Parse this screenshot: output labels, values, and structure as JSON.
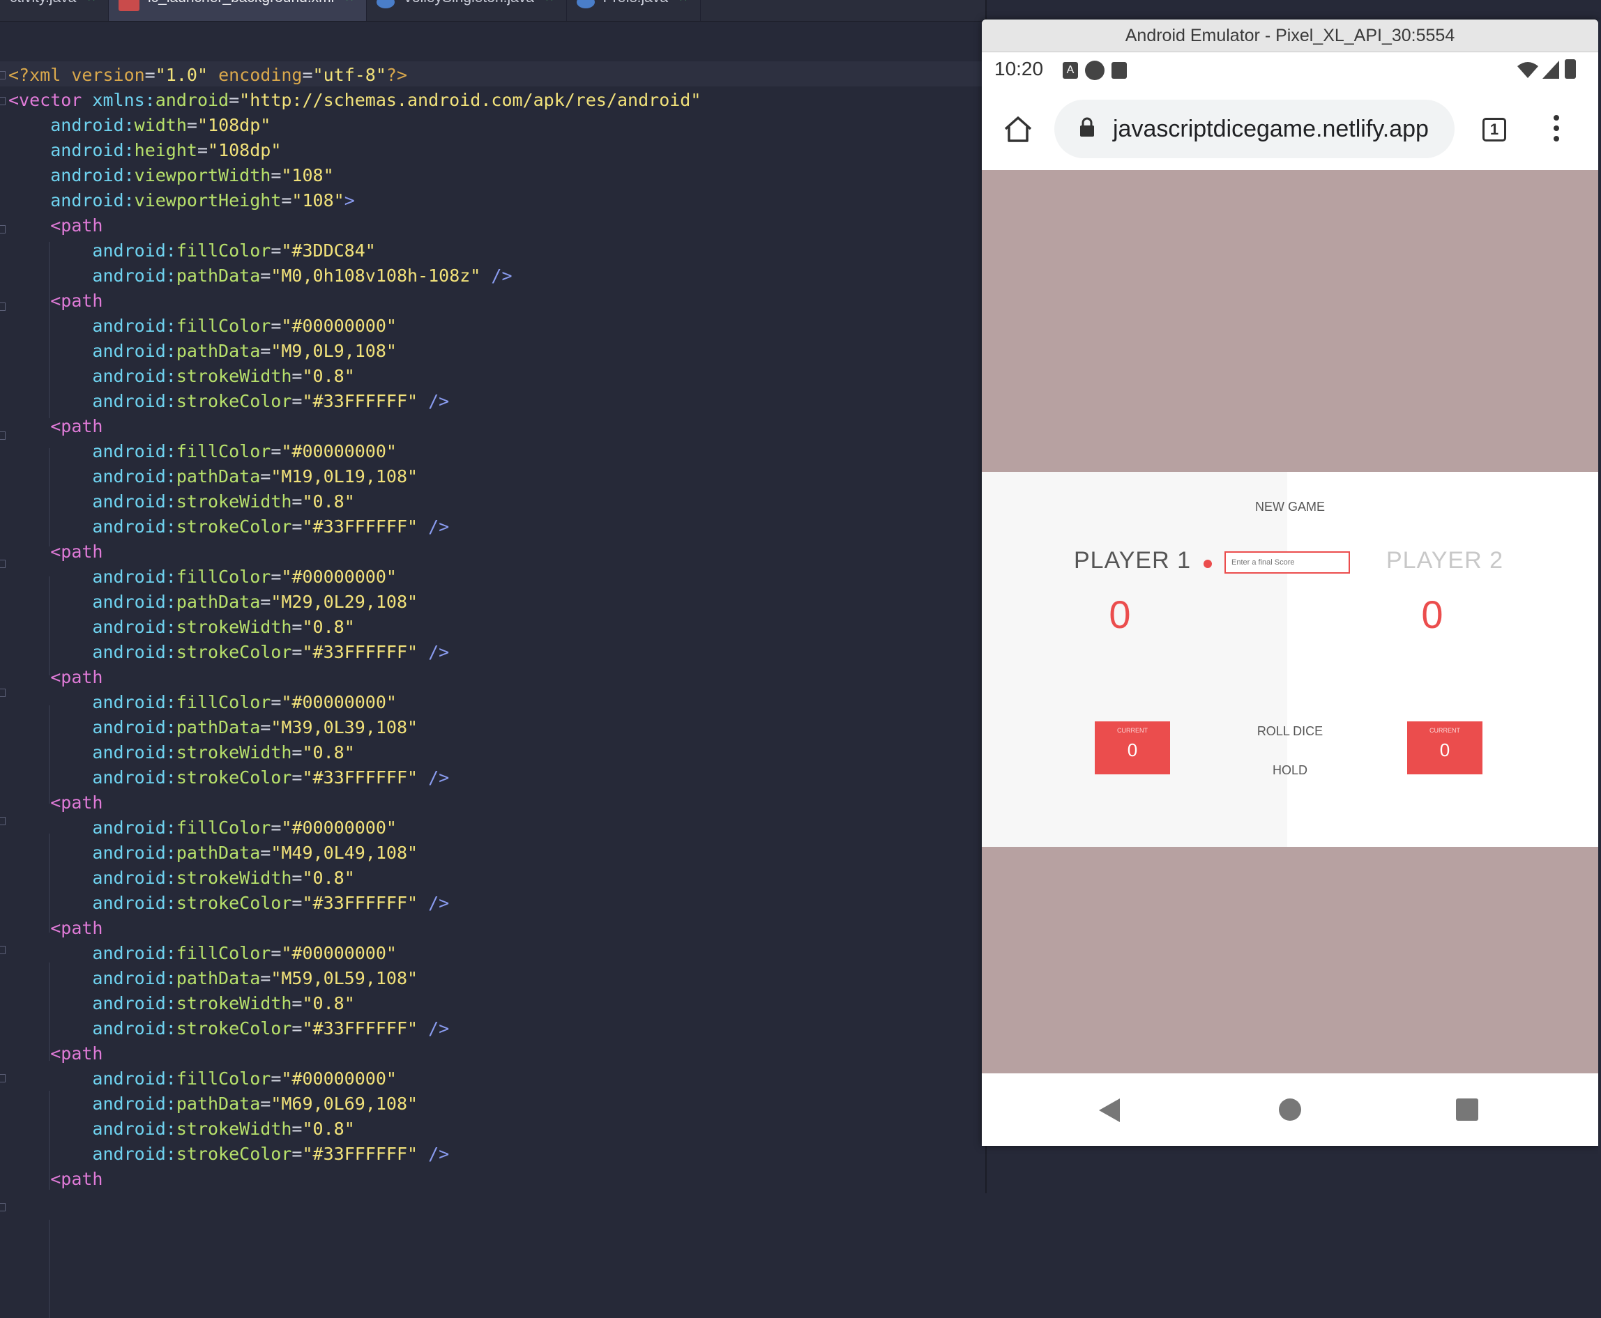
{
  "tabs": [
    {
      "label": "ctivity.java",
      "icon": "java-class-icon",
      "active": false
    },
    {
      "label": "ic_launcher_background.xml",
      "icon": "xml-file-icon",
      "active": true
    },
    {
      "label": "VolleySingleton.java",
      "icon": "java-class-icon",
      "active": false
    },
    {
      "label": "Prefs.java",
      "icon": "java-class-icon",
      "active": false
    }
  ],
  "emulator": {
    "title": "Android Emulator - Pixel_XL_API_30:5554",
    "status_time": "10:20",
    "url": "javascriptdicegame.netlify.app",
    "tab_count": "1"
  },
  "game": {
    "new_game": "NEW GAME",
    "player1": "PLAYER 1",
    "player2": "PLAYER 2",
    "final_score_placeholder": "Enter a final Score",
    "score1": "0",
    "score2": "0",
    "current_label": "CURRENT",
    "current1": "0",
    "current2": "0",
    "roll_dice": "ROLL DICE",
    "hold": "HOLD"
  },
  "code_lines": [
    [
      [
        "decl",
        "<?xml "
      ],
      [
        "decl",
        "version"
      ],
      [
        "plain",
        "="
      ],
      [
        "str",
        "\"1.0\""
      ],
      [
        "plain",
        " "
      ],
      [
        "decl",
        "encoding"
      ],
      [
        "plain",
        "="
      ],
      [
        "str",
        "\"utf-8\""
      ],
      [
        "decl",
        "?>"
      ]
    ],
    [
      [
        "tag",
        "<vector "
      ],
      [
        "ns",
        "xmlns:"
      ],
      [
        "attr",
        "android"
      ],
      [
        "plain",
        "="
      ],
      [
        "str",
        "\"http://schemas.android.com/apk/res/android\""
      ]
    ],
    [
      [
        "plain",
        "    "
      ],
      [
        "ns",
        "android:"
      ],
      [
        "attr",
        "width"
      ],
      [
        "plain",
        "="
      ],
      [
        "str",
        "\"108dp\""
      ]
    ],
    [
      [
        "plain",
        "    "
      ],
      [
        "ns",
        "android:"
      ],
      [
        "attr",
        "height"
      ],
      [
        "plain",
        "="
      ],
      [
        "str",
        "\"108dp\""
      ]
    ],
    [
      [
        "plain",
        "    "
      ],
      [
        "ns",
        "android:"
      ],
      [
        "attr",
        "viewportWidth"
      ],
      [
        "plain",
        "="
      ],
      [
        "str",
        "\"108\""
      ]
    ],
    [
      [
        "plain",
        "    "
      ],
      [
        "ns",
        "android:"
      ],
      [
        "attr",
        "viewportHeight"
      ],
      [
        "plain",
        "="
      ],
      [
        "str",
        "\"108\""
      ],
      [
        "punc",
        ">"
      ]
    ],
    [
      [
        "plain",
        "    "
      ],
      [
        "tag",
        "<path"
      ]
    ],
    [
      [
        "plain",
        "        "
      ],
      [
        "ns",
        "android:"
      ],
      [
        "attr",
        "fillColor"
      ],
      [
        "plain",
        "="
      ],
      [
        "str",
        "\"#3DDC84\""
      ]
    ],
    [
      [
        "plain",
        "        "
      ],
      [
        "ns",
        "android:"
      ],
      [
        "attr",
        "pathData"
      ],
      [
        "plain",
        "="
      ],
      [
        "str",
        "\"M0,0h108v108h-108z\""
      ],
      [
        "plain",
        " "
      ],
      [
        "punc",
        "/>"
      ]
    ],
    [
      [
        "plain",
        "    "
      ],
      [
        "tag",
        "<path"
      ]
    ],
    [
      [
        "plain",
        "        "
      ],
      [
        "ns",
        "android:"
      ],
      [
        "attr",
        "fillColor"
      ],
      [
        "plain",
        "="
      ],
      [
        "str",
        "\"#00000000\""
      ]
    ],
    [
      [
        "plain",
        "        "
      ],
      [
        "ns",
        "android:"
      ],
      [
        "attr",
        "pathData"
      ],
      [
        "plain",
        "="
      ],
      [
        "str",
        "\"M9,0L9,108\""
      ]
    ],
    [
      [
        "plain",
        "        "
      ],
      [
        "ns",
        "android:"
      ],
      [
        "attr",
        "strokeWidth"
      ],
      [
        "plain",
        "="
      ],
      [
        "str",
        "\"0.8\""
      ]
    ],
    [
      [
        "plain",
        "        "
      ],
      [
        "ns",
        "android:"
      ],
      [
        "attr",
        "strokeColor"
      ],
      [
        "plain",
        "="
      ],
      [
        "str",
        "\"#33FFFFFF\""
      ],
      [
        "plain",
        " "
      ],
      [
        "punc",
        "/>"
      ]
    ],
    [
      [
        "plain",
        "    "
      ],
      [
        "tag",
        "<path"
      ]
    ],
    [
      [
        "plain",
        "        "
      ],
      [
        "ns",
        "android:"
      ],
      [
        "attr",
        "fillColor"
      ],
      [
        "plain",
        "="
      ],
      [
        "str",
        "\"#00000000\""
      ]
    ],
    [
      [
        "plain",
        "        "
      ],
      [
        "ns",
        "android:"
      ],
      [
        "attr",
        "pathData"
      ],
      [
        "plain",
        "="
      ],
      [
        "str",
        "\"M19,0L19,108\""
      ]
    ],
    [
      [
        "plain",
        "        "
      ],
      [
        "ns",
        "android:"
      ],
      [
        "attr",
        "strokeWidth"
      ],
      [
        "plain",
        "="
      ],
      [
        "str",
        "\"0.8\""
      ]
    ],
    [
      [
        "plain",
        "        "
      ],
      [
        "ns",
        "android:"
      ],
      [
        "attr",
        "strokeColor"
      ],
      [
        "plain",
        "="
      ],
      [
        "str",
        "\"#33FFFFFF\""
      ],
      [
        "plain",
        " "
      ],
      [
        "punc",
        "/>"
      ]
    ],
    [
      [
        "plain",
        "    "
      ],
      [
        "tag",
        "<path"
      ]
    ],
    [
      [
        "plain",
        "        "
      ],
      [
        "ns",
        "android:"
      ],
      [
        "attr",
        "fillColor"
      ],
      [
        "plain",
        "="
      ],
      [
        "str",
        "\"#00000000\""
      ]
    ],
    [
      [
        "plain",
        "        "
      ],
      [
        "ns",
        "android:"
      ],
      [
        "attr",
        "pathData"
      ],
      [
        "plain",
        "="
      ],
      [
        "str",
        "\"M29,0L29,108\""
      ]
    ],
    [
      [
        "plain",
        "        "
      ],
      [
        "ns",
        "android:"
      ],
      [
        "attr",
        "strokeWidth"
      ],
      [
        "plain",
        "="
      ],
      [
        "str",
        "\"0.8\""
      ]
    ],
    [
      [
        "plain",
        "        "
      ],
      [
        "ns",
        "android:"
      ],
      [
        "attr",
        "strokeColor"
      ],
      [
        "plain",
        "="
      ],
      [
        "str",
        "\"#33FFFFFF\""
      ],
      [
        "plain",
        " "
      ],
      [
        "punc",
        "/>"
      ]
    ],
    [
      [
        "plain",
        "    "
      ],
      [
        "tag",
        "<path"
      ]
    ],
    [
      [
        "plain",
        "        "
      ],
      [
        "ns",
        "android:"
      ],
      [
        "attr",
        "fillColor"
      ],
      [
        "plain",
        "="
      ],
      [
        "str",
        "\"#00000000\""
      ]
    ],
    [
      [
        "plain",
        "        "
      ],
      [
        "ns",
        "android:"
      ],
      [
        "attr",
        "pathData"
      ],
      [
        "plain",
        "="
      ],
      [
        "str",
        "\"M39,0L39,108\""
      ]
    ],
    [
      [
        "plain",
        "        "
      ],
      [
        "ns",
        "android:"
      ],
      [
        "attr",
        "strokeWidth"
      ],
      [
        "plain",
        "="
      ],
      [
        "str",
        "\"0.8\""
      ]
    ],
    [
      [
        "plain",
        "        "
      ],
      [
        "ns",
        "android:"
      ],
      [
        "attr",
        "strokeColor"
      ],
      [
        "plain",
        "="
      ],
      [
        "str",
        "\"#33FFFFFF\""
      ],
      [
        "plain",
        " "
      ],
      [
        "punc",
        "/>"
      ]
    ],
    [
      [
        "plain",
        "    "
      ],
      [
        "tag",
        "<path"
      ]
    ],
    [
      [
        "plain",
        "        "
      ],
      [
        "ns",
        "android:"
      ],
      [
        "attr",
        "fillColor"
      ],
      [
        "plain",
        "="
      ],
      [
        "str",
        "\"#00000000\""
      ]
    ],
    [
      [
        "plain",
        "        "
      ],
      [
        "ns",
        "android:"
      ],
      [
        "attr",
        "pathData"
      ],
      [
        "plain",
        "="
      ],
      [
        "str",
        "\"M49,0L49,108\""
      ]
    ],
    [
      [
        "plain",
        "        "
      ],
      [
        "ns",
        "android:"
      ],
      [
        "attr",
        "strokeWidth"
      ],
      [
        "plain",
        "="
      ],
      [
        "str",
        "\"0.8\""
      ]
    ],
    [
      [
        "plain",
        "        "
      ],
      [
        "ns",
        "android:"
      ],
      [
        "attr",
        "strokeColor"
      ],
      [
        "plain",
        "="
      ],
      [
        "str",
        "\"#33FFFFFF\""
      ],
      [
        "plain",
        " "
      ],
      [
        "punc",
        "/>"
      ]
    ],
    [
      [
        "plain",
        "    "
      ],
      [
        "tag",
        "<path"
      ]
    ],
    [
      [
        "plain",
        "        "
      ],
      [
        "ns",
        "android:"
      ],
      [
        "attr",
        "fillColor"
      ],
      [
        "plain",
        "="
      ],
      [
        "str",
        "\"#00000000\""
      ]
    ],
    [
      [
        "plain",
        "        "
      ],
      [
        "ns",
        "android:"
      ],
      [
        "attr",
        "pathData"
      ],
      [
        "plain",
        "="
      ],
      [
        "str",
        "\"M59,0L59,108\""
      ]
    ],
    [
      [
        "plain",
        "        "
      ],
      [
        "ns",
        "android:"
      ],
      [
        "attr",
        "strokeWidth"
      ],
      [
        "plain",
        "="
      ],
      [
        "str",
        "\"0.8\""
      ]
    ],
    [
      [
        "plain",
        "        "
      ],
      [
        "ns",
        "android:"
      ],
      [
        "attr",
        "strokeColor"
      ],
      [
        "plain",
        "="
      ],
      [
        "str",
        "\"#33FFFFFF\""
      ],
      [
        "plain",
        " "
      ],
      [
        "punc",
        "/>"
      ]
    ],
    [
      [
        "plain",
        "    "
      ],
      [
        "tag",
        "<path"
      ]
    ],
    [
      [
        "plain",
        "        "
      ],
      [
        "ns",
        "android:"
      ],
      [
        "attr",
        "fillColor"
      ],
      [
        "plain",
        "="
      ],
      [
        "str",
        "\"#00000000\""
      ]
    ],
    [
      [
        "plain",
        "        "
      ],
      [
        "ns",
        "android:"
      ],
      [
        "attr",
        "pathData"
      ],
      [
        "plain",
        "="
      ],
      [
        "str",
        "\"M69,0L69,108\""
      ]
    ],
    [
      [
        "plain",
        "        "
      ],
      [
        "ns",
        "android:"
      ],
      [
        "attr",
        "strokeWidth"
      ],
      [
        "plain",
        "="
      ],
      [
        "str",
        "\"0.8\""
      ]
    ],
    [
      [
        "plain",
        "        "
      ],
      [
        "ns",
        "android:"
      ],
      [
        "attr",
        "strokeColor"
      ],
      [
        "plain",
        "="
      ],
      [
        "str",
        "\"#33FFFFFF\""
      ],
      [
        "plain",
        " "
      ],
      [
        "punc",
        "/>"
      ]
    ],
    [
      [
        "plain",
        "    "
      ],
      [
        "tag",
        "<path"
      ]
    ]
  ],
  "colors": {
    "editor_bg": "#262938",
    "game_accent": "#EB4D4D",
    "page_bg": "#B7A1A1"
  }
}
